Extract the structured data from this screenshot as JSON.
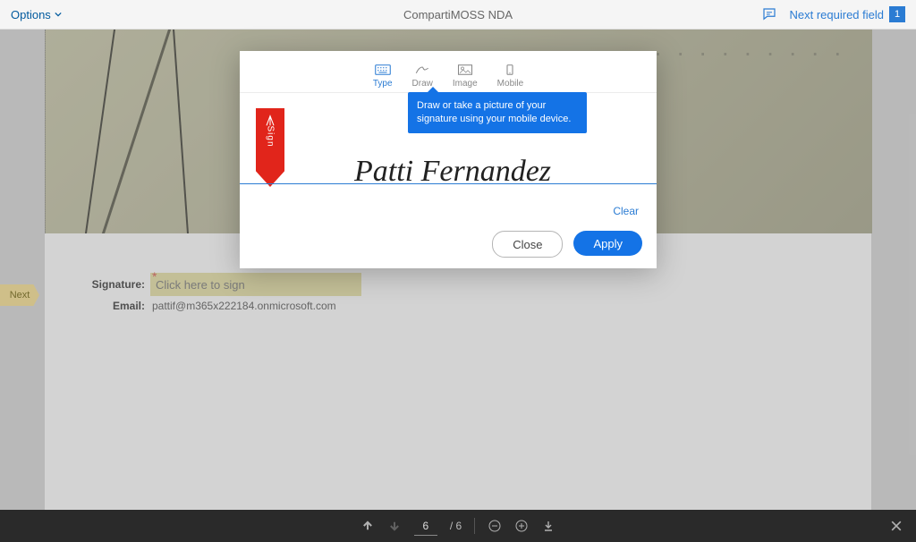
{
  "topbar": {
    "options": "Options",
    "docTitle": "CompartiMOSS NDA",
    "nextRequired": "Next required field",
    "nextCount": "1"
  },
  "nextFlag": "Next",
  "form": {
    "sigLabel": "Signature:",
    "sigPlaceholder": "Click here to sign",
    "emailLabel": "Email:",
    "emailValue": "pattif@m365x222184.onmicrosoft.com"
  },
  "modal": {
    "tabs": {
      "type": "Type",
      "draw": "Draw",
      "image": "Image",
      "mobile": "Mobile"
    },
    "tooltip": "Draw or take a picture of your signature using your mobile device.",
    "ribbon": "Sign",
    "signature": "Patti Fernandez",
    "clear": "Clear",
    "close": "Close",
    "apply": "Apply"
  },
  "bottombar": {
    "page": "6",
    "total": "/ 6"
  }
}
